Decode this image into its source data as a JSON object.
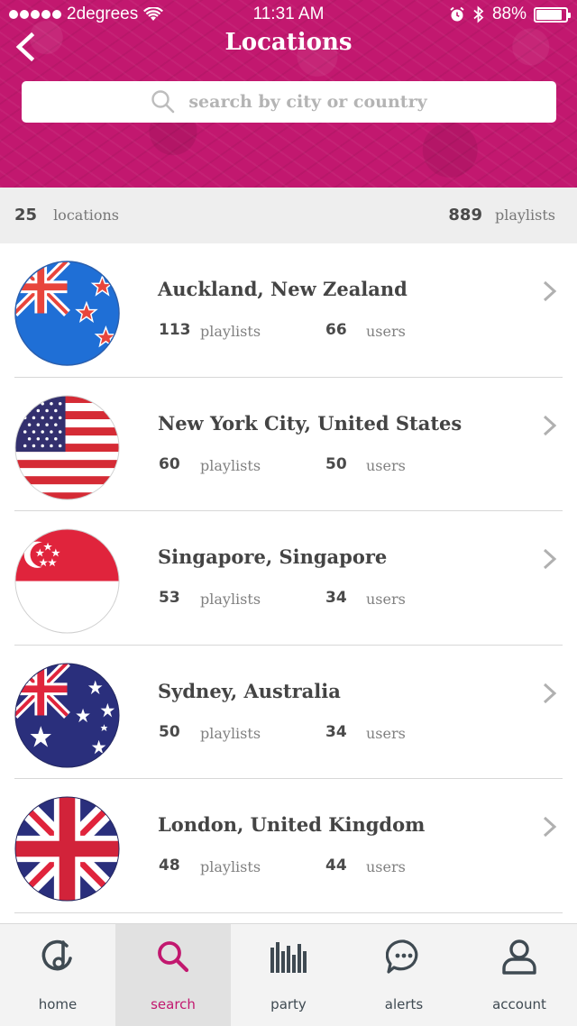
{
  "status_bar": {
    "carrier": "2degrees",
    "time": "11:31 AM",
    "battery_percent": "88%",
    "battery_level": 0.88
  },
  "header": {
    "title": "Locations",
    "search_placeholder": "search by city or country"
  },
  "summary": {
    "location_count": "25",
    "location_label": "locations",
    "playlist_count": "889",
    "playlist_label": "playlists"
  },
  "locations": [
    {
      "name": "Auckland, New Zealand",
      "playlists": "113",
      "users": "66",
      "flag": "new-zealand-flag"
    },
    {
      "name": "New York City, United States",
      "playlists": "60",
      "users": "50",
      "flag": "united-states-flag"
    },
    {
      "name": "Singapore, Singapore",
      "playlists": "53",
      "users": "34",
      "flag": "singapore-flag"
    },
    {
      "name": "Sydney, Australia",
      "playlists": "50",
      "users": "34",
      "flag": "australia-flag"
    },
    {
      "name": "London, United Kingdom",
      "playlists": "48",
      "users": "44",
      "flag": "united-kingdom-flag"
    }
  ],
  "row_labels": {
    "playlists": "playlists",
    "users": "users"
  },
  "tabs": [
    {
      "label": "home",
      "icon": "home-icon",
      "active": false
    },
    {
      "label": "search",
      "icon": "search-icon",
      "active": true
    },
    {
      "label": "party",
      "icon": "party-icon",
      "active": false
    },
    {
      "label": "alerts",
      "icon": "alerts-icon",
      "active": false
    },
    {
      "label": "account",
      "icon": "account-icon",
      "active": false
    }
  ],
  "colors": {
    "brand": "#c2186f",
    "text_dark": "#444444",
    "icon_dark": "#3f4a52"
  }
}
